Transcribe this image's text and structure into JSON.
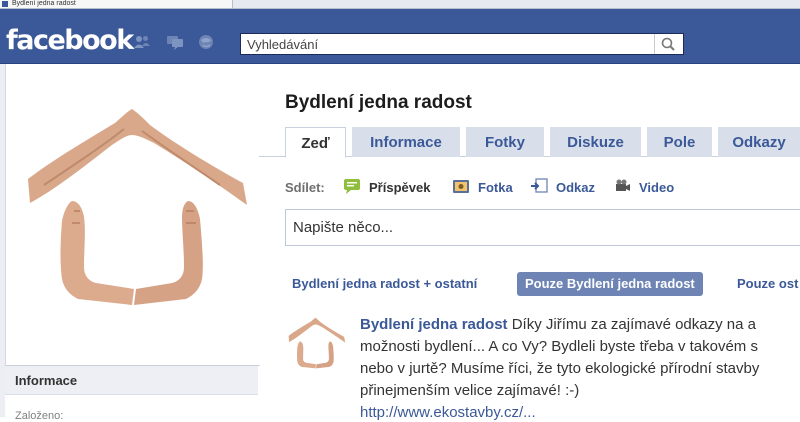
{
  "browser": {
    "tab_title": "Bydlení jedna radost"
  },
  "header": {
    "logo": "facebook",
    "jewels": [
      "friends-icon",
      "messages-icon",
      "notifications-icon"
    ],
    "search": {
      "placeholder": "Vyhledávání",
      "value": ""
    },
    "colors": {
      "bar": "#3b5998",
      "text": "#ffffff"
    }
  },
  "profile": {
    "info_title": "Informace",
    "founded_label": "Založeno:"
  },
  "page": {
    "name": "Bydlení jedna radost",
    "tabs": [
      {
        "label": "Zeď",
        "active": true
      },
      {
        "label": "Informace",
        "active": false
      },
      {
        "label": "Fotky",
        "active": false
      },
      {
        "label": "Diskuze",
        "active": false
      },
      {
        "label": "Pole",
        "active": false
      },
      {
        "label": "Odkazy",
        "active": false
      }
    ]
  },
  "share": {
    "label": "Sdílet:",
    "items": [
      {
        "label": "Příspěvek",
        "icon": "status-icon"
      },
      {
        "label": "Fotka",
        "icon": "photo-icon"
      },
      {
        "label": "Odkaz",
        "icon": "link-icon"
      },
      {
        "label": "Video",
        "icon": "video-icon"
      }
    ]
  },
  "composer": {
    "placeholder": "Napište něco..."
  },
  "filters": [
    {
      "label": "Bydlení jedna radost + ostatní",
      "active": false
    },
    {
      "label": "Pouze Bydlení jedna radost",
      "active": true
    },
    {
      "label": "Pouze ost",
      "active": false
    }
  ],
  "post": {
    "author": "Bydlení jedna radost",
    "lines": [
      "Díky Jiřímu za zajímavé odkazy na a",
      "možnosti bydlení... A co Vy? Bydleli byste třeba v takovém s",
      "nebo v jurtě? Musíme říci, že tyto ekologické přírodní stavby",
      "přinejmenším velice zajímavé! :-)"
    ],
    "link_partial": "http://www.ekostavby.cz/..."
  }
}
